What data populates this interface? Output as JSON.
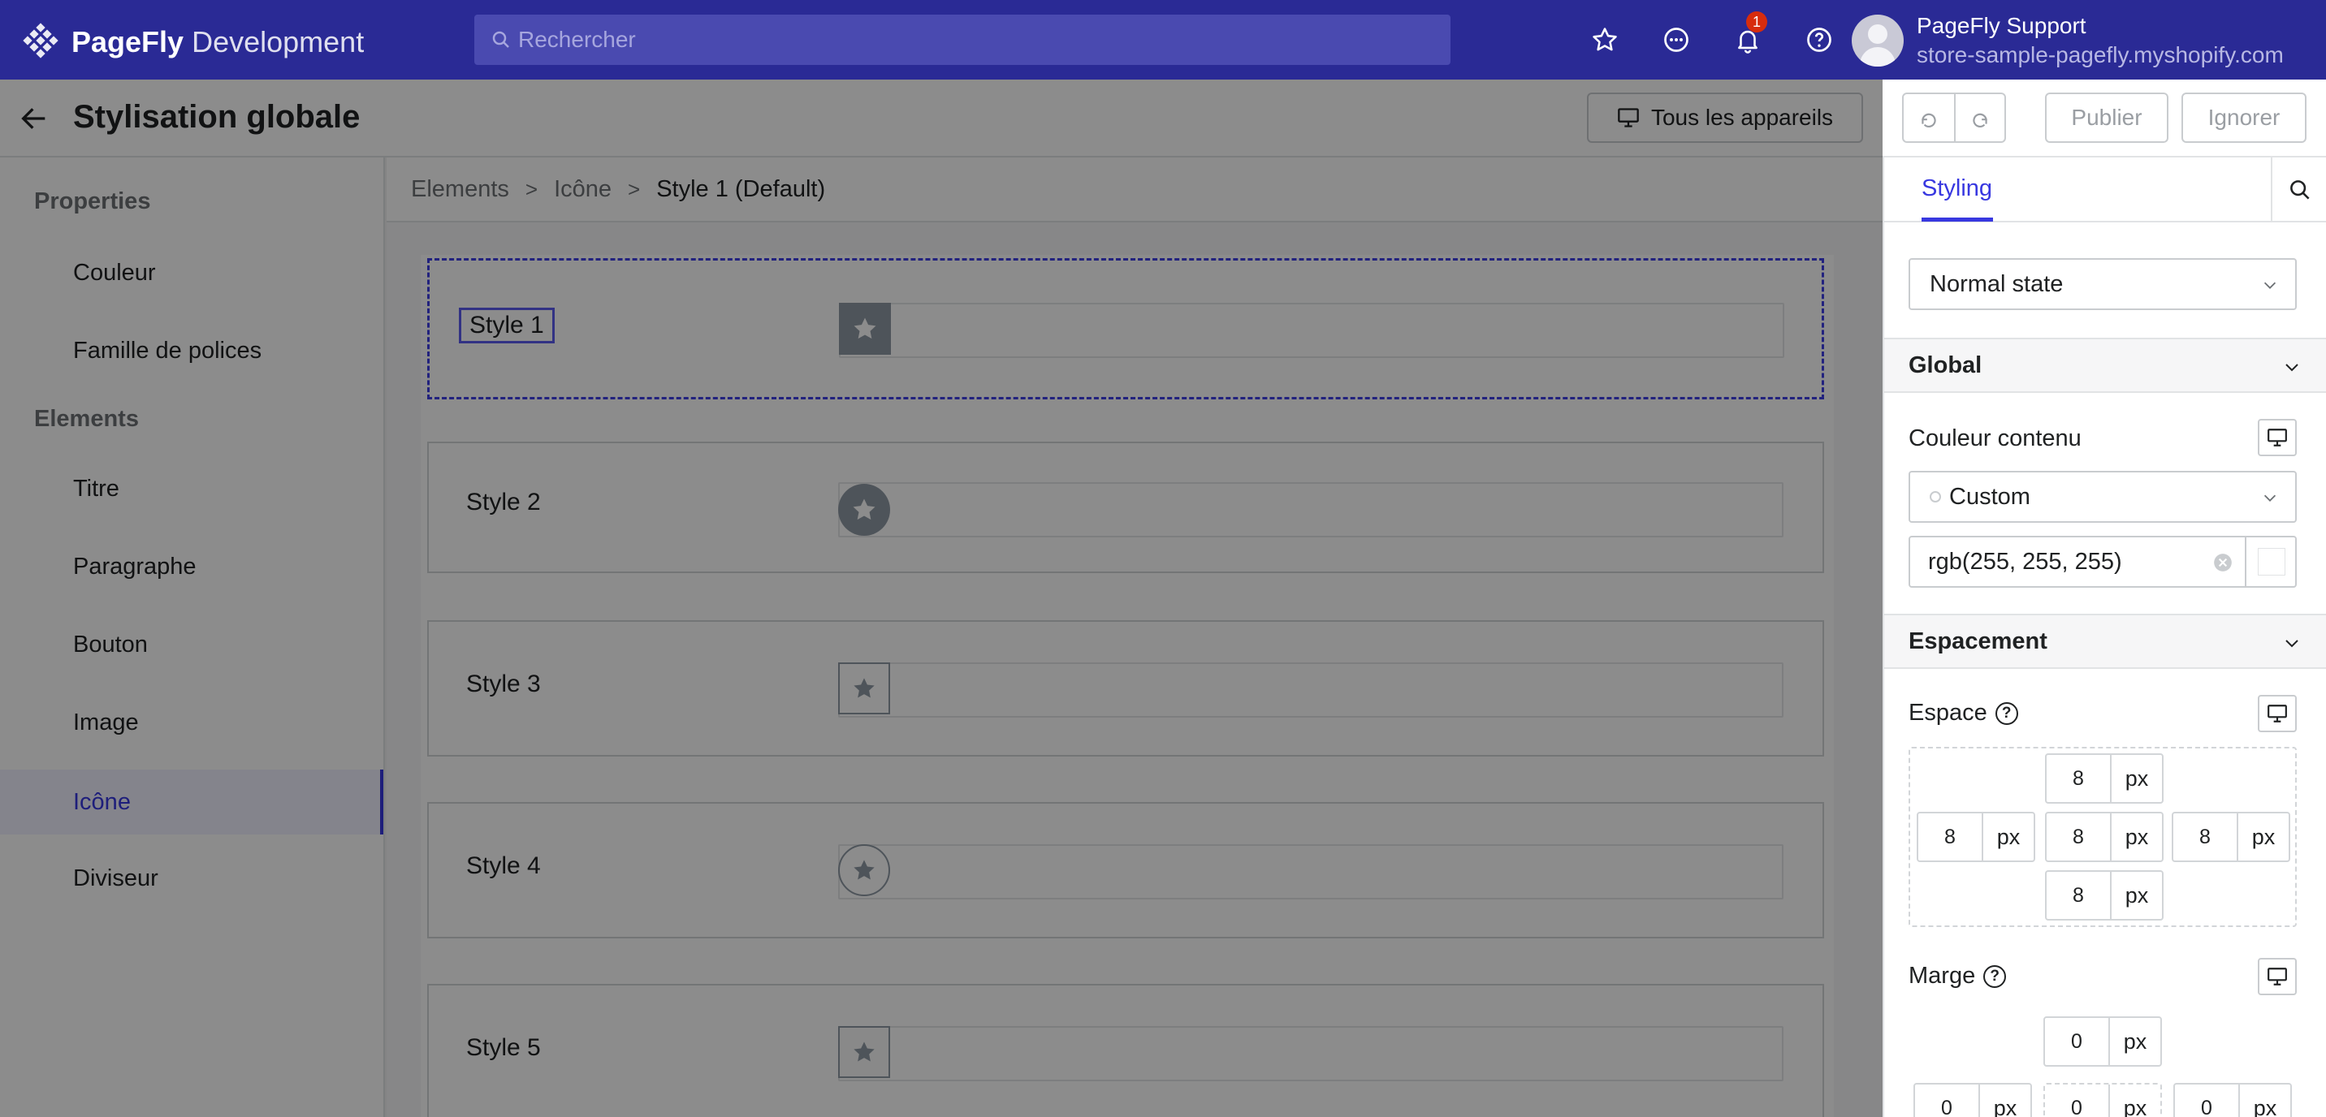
{
  "topbar": {
    "brand": "PageFly",
    "brand_suffix": "Development",
    "search_placeholder": "Rechercher",
    "notification_count": "1",
    "user_name": "PageFly Support",
    "user_store": "store-sample-pagefly.myshopify.com"
  },
  "header": {
    "title": "Stylisation globale",
    "devices_label": "Tous les appareils",
    "publish_label": "Publier",
    "ignore_label": "Ignorer"
  },
  "sidebar": {
    "properties_title": "Properties",
    "properties": [
      "Couleur",
      "Famille de polices"
    ],
    "elements_title": "Elements",
    "elements": [
      "Titre",
      "Paragraphe",
      "Bouton",
      "Image",
      "Icône",
      "Diviseur"
    ],
    "active": "Icône"
  },
  "breadcrumb": [
    "Elements",
    "Icône",
    "Style 1 (Default)"
  ],
  "styles": [
    "Style 1",
    "Style 2",
    "Style 3",
    "Style 4",
    "Style 5"
  ],
  "panel": {
    "tab": "Styling",
    "state": "Normal state",
    "global_title": "Global",
    "content_color_label": "Couleur contenu",
    "color_mode": "Custom",
    "color_value": "rgb(255, 255, 255)",
    "spacing_title": "Espacement",
    "padding_label": "Espace",
    "padding": {
      "top": "8",
      "left": "8",
      "center": "8",
      "right": "8",
      "bottom": "8",
      "unit": "px"
    },
    "margin_label": "Marge",
    "margin": {
      "top": "0",
      "left": "0",
      "center": "0",
      "right": "0",
      "unit": "px"
    }
  },
  "colors": {
    "primary": "#2a2a95",
    "accent": "#3838e0",
    "icon_gray": "#8f9aa5"
  }
}
